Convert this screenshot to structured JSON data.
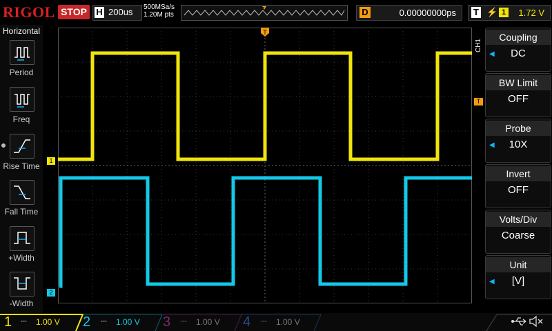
{
  "brand": "RIGOL",
  "run_status": "STOP",
  "horizontal": {
    "tag": "H",
    "timebase": "200us",
    "sample_rate": "500MSa/s",
    "points": "1.20M pts"
  },
  "delay": {
    "tag": "D",
    "value": "0.00000000ps"
  },
  "trigger": {
    "tag": "T",
    "edge_icon": "rising-edge-icon",
    "source": "1",
    "level": "1.72 V"
  },
  "left_panel": {
    "title": "Horizontal",
    "items": [
      {
        "label": "Period",
        "icon": "period-icon"
      },
      {
        "label": "Freq",
        "icon": "freq-icon"
      },
      {
        "label": "Rise Time",
        "icon": "rise-time-icon"
      },
      {
        "label": "Fall Time",
        "icon": "fall-time-icon"
      },
      {
        "label": "+Width",
        "icon": "pos-width-icon"
      },
      {
        "label": "-Width",
        "icon": "neg-width-icon"
      }
    ]
  },
  "right_panel": {
    "channel_tag": "CH1",
    "menus": [
      {
        "title": "Coupling",
        "value": "DC"
      },
      {
        "title": "BW Limit",
        "value": "OFF"
      },
      {
        "title": "Probe",
        "value": "10X"
      },
      {
        "title": "Invert",
        "value": "OFF"
      },
      {
        "title": "Volts/Div",
        "value": "Coarse"
      },
      {
        "title": "Unit",
        "value": "[V]"
      }
    ]
  },
  "channels": [
    {
      "num": "1",
      "scale": "1.00 V",
      "color": "#f1e40c",
      "active": true
    },
    {
      "num": "2",
      "scale": "1.00 V",
      "color": "#14c8e8",
      "active": true
    },
    {
      "num": "3",
      "scale": "1.00 V",
      "color": "#c23bb2",
      "active": false
    },
    {
      "num": "4",
      "scale": "1.00 V",
      "color": "#3b6ed1",
      "active": false
    }
  ],
  "waveform_labels": {
    "ch1_marker": "1",
    "ch2_marker": "2",
    "trigger_marker": "T"
  },
  "colors": {
    "ch1": "#f1e40c",
    "ch2": "#14c8e8",
    "stop": "#c62828",
    "brand": "#d91f26",
    "trigger": "#f39c12",
    "menu_arrow": "#0ab8ff"
  },
  "status_icons": [
    "usb-icon",
    "speaker-muted-icon"
  ]
}
